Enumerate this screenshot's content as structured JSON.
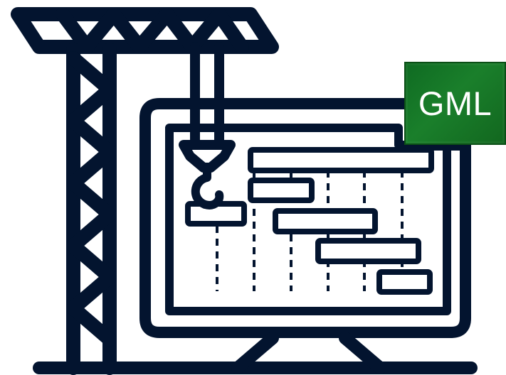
{
  "badge": {
    "label": "GML",
    "background_color": "#1a7f2b",
    "text_color": "#ffffff"
  },
  "illustration": {
    "subject": "crane-lifting-gantry-chart-on-monitor",
    "line_color": "#03142f",
    "icons": [
      "crane-icon",
      "monitor-icon",
      "gantt-chart-icon",
      "hook-icon"
    ]
  }
}
